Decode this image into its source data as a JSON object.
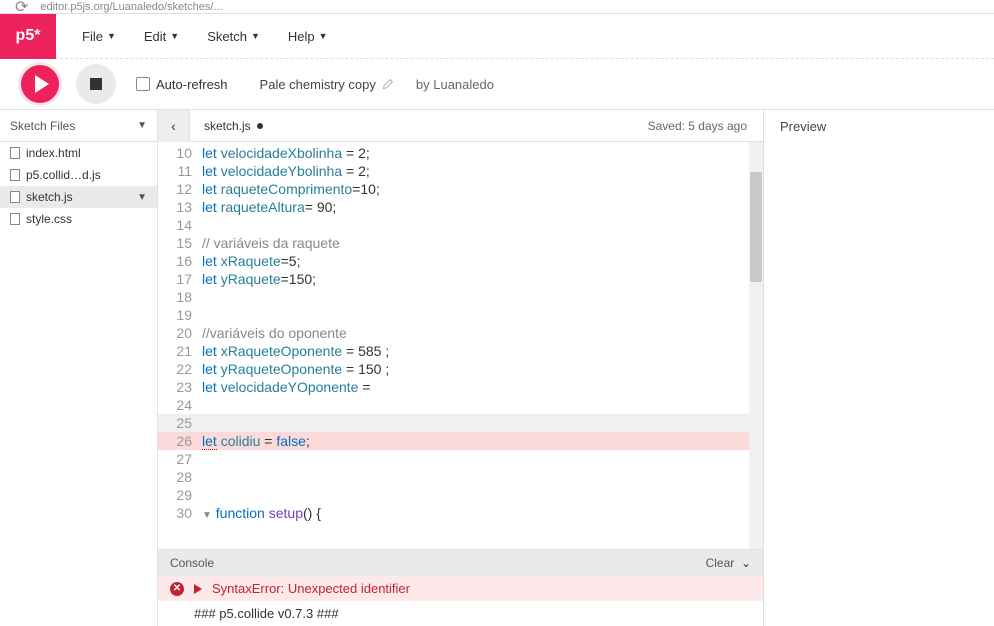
{
  "browser": {
    "url_fragment": "editor.p5js.org/Luanaledo/sketches/..."
  },
  "logo": "p5*",
  "menu": {
    "file": "File",
    "edit": "Edit",
    "sketch": "Sketch",
    "help": "Help"
  },
  "toolbar": {
    "auto_refresh": "Auto-refresh",
    "sketch_name": "Pale chemistry copy",
    "by": "by",
    "author": "Luanaledo"
  },
  "sidebar": {
    "title": "Sketch Files",
    "files": {
      "f0": "index.html",
      "f1": "p5.collid…d.js",
      "f2": "sketch.js",
      "f3": "style.css"
    }
  },
  "editor": {
    "tab": "sketch.js",
    "saved": "Saved: 5 days ago",
    "gutter": {
      "l0": "10",
      "l1": "11",
      "l2": "12",
      "l3": "13",
      "l4": "14",
      "l5": "15",
      "l6": "16",
      "l7": "17",
      "l8": "18",
      "l9": "19",
      "l10": "20",
      "l11": "21",
      "l12": "22",
      "l13": "23",
      "l14": "24",
      "l15": "25",
      "l16": "26",
      "l17": "27",
      "l18": "28",
      "l19": "29",
      "l20": "30"
    }
  },
  "code": {
    "let": "let",
    "l10_var": "velocidadeXbolinha",
    "l10_rest": " = 2;",
    "l11_var": "velocidadeYbolinha",
    "l11_rest": " = 2;",
    "l12_var": "raqueteComprimento",
    "l12_rest": "=10;",
    "l13_var": "raqueteAltura",
    "l13_rest": "= 90;",
    "l15_cmt": "// variáveis da raquete",
    "l16_var": "xRaquete",
    "l16_rest": "=5;",
    "l17_var": "yRaquete",
    "l17_rest": "=150;",
    "l20_cmt": "//variáveis do oponente",
    "l21_var": "xRaqueteOponente",
    "l21_rest": " = 585 ;",
    "l22_var": "yRaqueteOponente",
    "l22_rest": " = 150 ;",
    "l23_var": "velocidadeYOponente",
    "l23_rest": " = ",
    "l26_var": "colidiu",
    "l26_eq": " = ",
    "l26_bool": "false",
    "l26_semi": ";",
    "func": "function",
    "setup": "setup",
    "l30_rest": "() {"
  },
  "console": {
    "title": "Console",
    "clear": "Clear",
    "error": "SyntaxError: Unexpected identifier",
    "log": "### p5.collide v0.7.3 ###"
  },
  "preview": {
    "title": "Preview"
  }
}
